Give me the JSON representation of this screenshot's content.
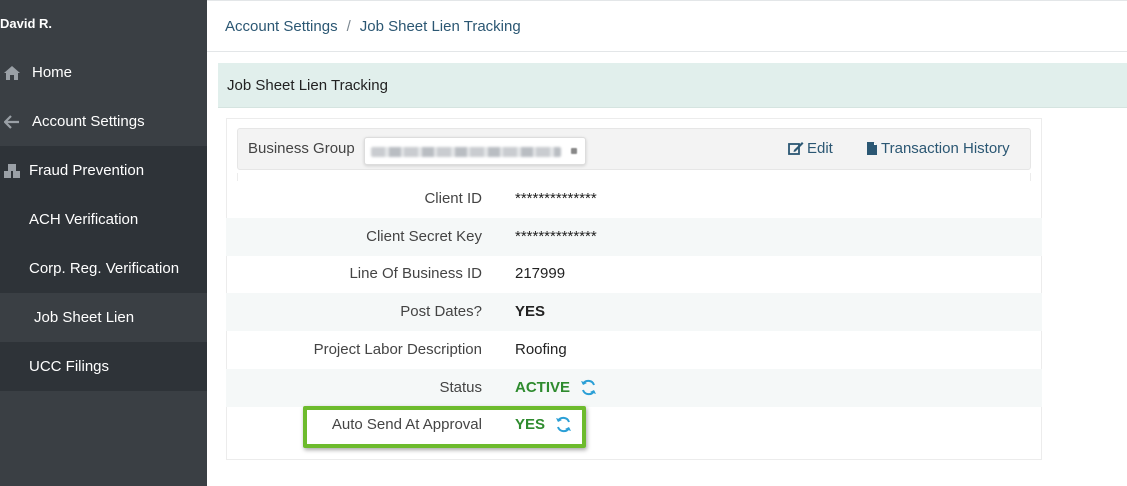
{
  "user": {
    "name": "David R."
  },
  "sidebar": {
    "items": [
      {
        "label": "Home",
        "icon": "home-icon"
      },
      {
        "label": "Account Settings",
        "icon": "arrow-left-icon"
      },
      {
        "label": "Fraud Prevention",
        "icon": "cubes-icon"
      },
      {
        "label": "ACH Verification"
      },
      {
        "label": "Corp. Reg. Verification"
      },
      {
        "label": "Job Sheet Lien",
        "active": true
      },
      {
        "label": "UCC Filings"
      }
    ]
  },
  "breadcrumb": {
    "parent": "Account Settings",
    "separator": "/",
    "current": "Job Sheet Lien Tracking"
  },
  "panel": {
    "title": "Job Sheet Lien Tracking",
    "business_group_label": "Business Group",
    "edit_label": "Edit",
    "history_label": "Transaction History"
  },
  "fields": [
    {
      "label": "Client ID",
      "value": "**************"
    },
    {
      "label": "Client Secret Key",
      "value": "**************"
    },
    {
      "label": "Line Of Business ID",
      "value": "217999"
    },
    {
      "label": "Post Dates?",
      "value": "YES"
    },
    {
      "label": "Project Labor Description",
      "value": "Roofing"
    },
    {
      "label": "Status",
      "value": "ACTIVE"
    },
    {
      "label": "Auto Send At Approval",
      "value": "YES"
    }
  ],
  "colors": {
    "sidebar": "#3a3f44",
    "link": "#2b5773",
    "status_green": "#2e8b2e",
    "highlight": "#6dbb2d",
    "refresh_icon": "#2a9fd6"
  }
}
